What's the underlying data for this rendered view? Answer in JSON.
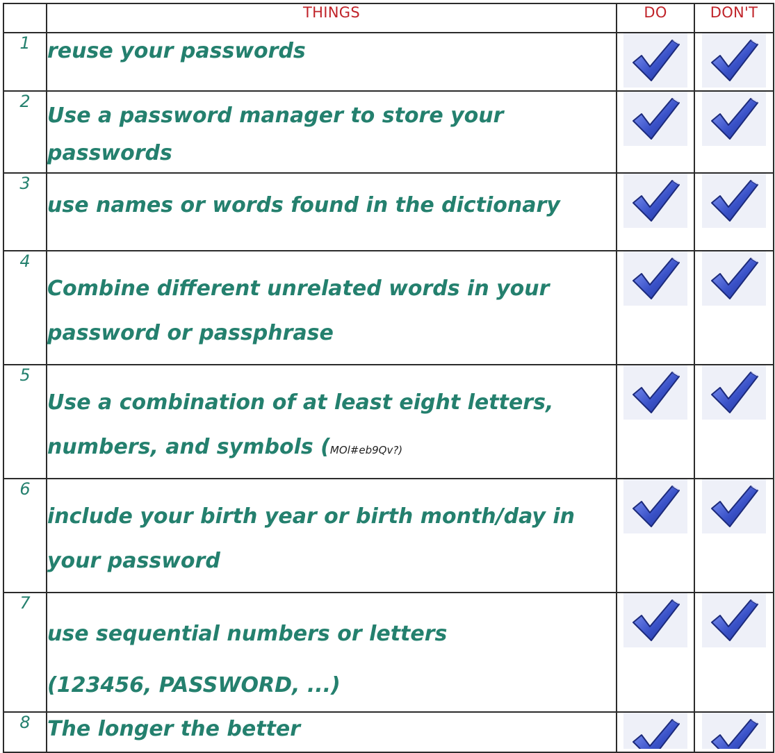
{
  "header": {
    "number": "",
    "things": "THINGS",
    "do": "DO",
    "dont": "DON'T"
  },
  "rows": [
    {
      "number": "1",
      "lines": [
        "reuse your passwords"
      ],
      "code": ""
    },
    {
      "number": "2",
      "lines": [
        "Use a password manager to store your",
        "passwords"
      ],
      "code": ""
    },
    {
      "number": "3",
      "lines": [
        "use names or words found in the dictionary"
      ],
      "code": ""
    },
    {
      "number": "4",
      "lines": [
        "Combine different unrelated words in your",
        "password or passphrase"
      ],
      "code": ""
    },
    {
      "number": "5",
      "lines": [
        "Use a combination of at least eight letters,",
        "numbers, and symbols ("
      ],
      "code": "MOl#eb9Qv?)"
    },
    {
      "number": "6",
      "lines": [
        "include your birth year or birth month/day in",
        "your password"
      ],
      "code": ""
    },
    {
      "number": "7",
      "lines": [
        "use sequential numbers or letters",
        "(123456, PASSWORD, ...)"
      ],
      "code": ""
    },
    {
      "number": "8",
      "lines": [
        "The longer the better"
      ],
      "code": ""
    }
  ],
  "icons": {
    "check": "checkmark-icon"
  },
  "colors": {
    "header_text": "#c0242a",
    "body_text": "#24806e",
    "check_fill": "#3a52c8"
  }
}
